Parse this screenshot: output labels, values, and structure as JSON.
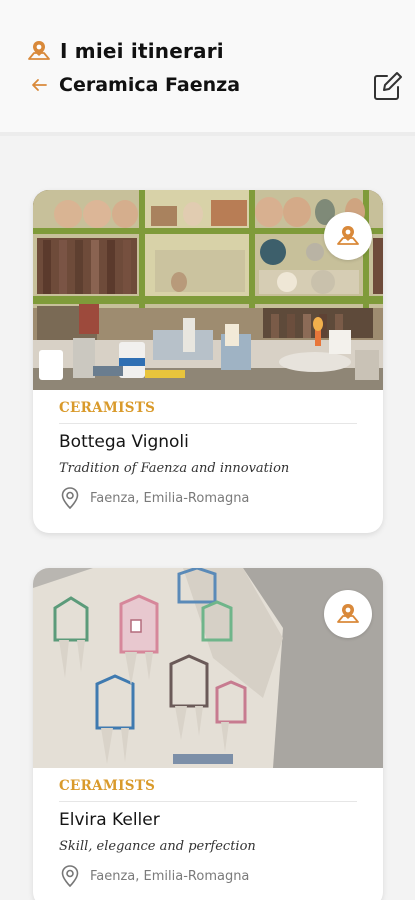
{
  "header": {
    "app_title": "I miei itinerari",
    "itinerary_title": "Ceramica Faenza"
  },
  "cards": [
    {
      "category": "CERAMISTS",
      "name": "Bottega Vignoli",
      "tagline": "Tradition of Faenza and innovation",
      "location": "Faenza, Emilia-Romagna"
    },
    {
      "category": "CERAMISTS",
      "name": "Elvira Keller",
      "tagline": "Skill, elegance and perfection",
      "location": "Faenza, Emilia-Romagna"
    }
  ],
  "colors": {
    "accent": "#d99a2b",
    "pin_icon": "#d9893a",
    "background": "#f3f3f3"
  },
  "icons": [
    "map-pin-icon",
    "back-arrow-icon",
    "edit-icon",
    "add-to-itinerary-icon",
    "location-pin-icon"
  ]
}
